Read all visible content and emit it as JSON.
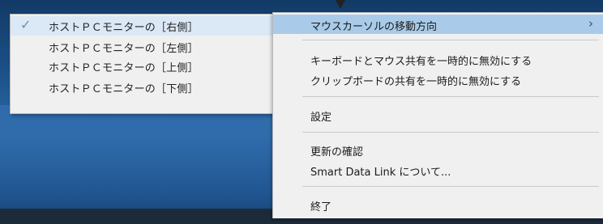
{
  "submenu": {
    "items": [
      {
        "label": "ホストＰＣモニターの［右側］",
        "checked": true
      },
      {
        "label": "ホストＰＣモニターの［左側］",
        "checked": false
      },
      {
        "label": "ホストＰＣモニターの［上側］",
        "checked": false
      },
      {
        "label": "ホストＰＣモニターの［下側］",
        "checked": false
      }
    ],
    "check_glyph": "✓"
  },
  "menu": {
    "mouse_direction": "マウスカーソルの移動方向",
    "submenu_arrow": "›",
    "disable_kb_mouse": "キーボードとマウス共有を一時的に無効にする",
    "disable_clipboard": "クリップボードの共有を一時的に無効にする",
    "settings": "設定",
    "check_update": "更新の確認",
    "about": "Smart Data Link について...",
    "exit": "終了"
  },
  "colors": {
    "highlight": "#a9cbe9",
    "submenu_active": "#dbe8f5",
    "menu_bg": "#f0f0f0"
  }
}
